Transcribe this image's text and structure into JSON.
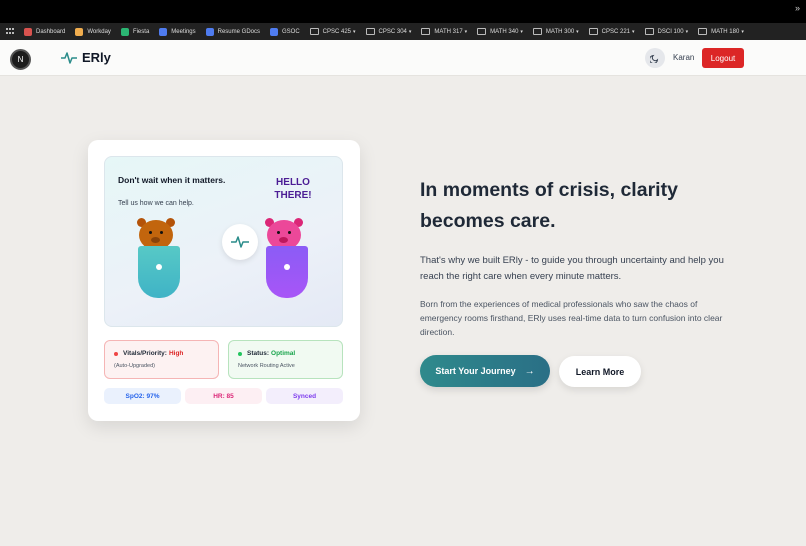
{
  "bookmarks": {
    "items": [
      {
        "label": "Dashboard",
        "icon": "dashboard-bookmark-icon",
        "color": "#d9534f",
        "folder": false
      },
      {
        "label": "Workday",
        "icon": "workday-bookmark-icon",
        "color": "#f0ad4e",
        "folder": false
      },
      {
        "label": "Fiesta",
        "icon": "fiesta-bookmark-icon",
        "color": "#2bb673",
        "folder": false
      },
      {
        "label": "Meetings",
        "icon": "doc-bookmark-icon",
        "color": "#4f7cf0",
        "folder": false
      },
      {
        "label": "Resume GDocs",
        "icon": "doc-bookmark-icon",
        "color": "#4f7cf0",
        "folder": false
      },
      {
        "label": "GSOC",
        "icon": "doc-bookmark-icon",
        "color": "#4f7cf0",
        "folder": false
      },
      {
        "label": "CPSC 425",
        "icon": "folder-icon",
        "folder": true
      },
      {
        "label": "CPSC 304",
        "icon": "folder-icon",
        "folder": true
      },
      {
        "label": "MATH 317",
        "icon": "folder-icon",
        "folder": true
      },
      {
        "label": "MATH 340",
        "icon": "folder-icon",
        "folder": true
      },
      {
        "label": "MATH 300",
        "icon": "folder-icon",
        "folder": true
      },
      {
        "label": "CPSC 221",
        "icon": "folder-icon",
        "folder": true
      },
      {
        "label": "DSCI 100",
        "icon": "folder-icon",
        "folder": true
      },
      {
        "label": "MATH 180",
        "icon": "folder-icon",
        "folder": true
      }
    ],
    "more": "»"
  },
  "header": {
    "badge": "N",
    "brand": "ERly",
    "user": "Karan",
    "logout": "Logout",
    "accent": "#dc2626"
  },
  "card": {
    "tagline": "Don't wait when it matters.",
    "subtagline": "Tell us how we can help.",
    "greeting": "HELLO THERE!",
    "vitals_label": "Vitals/Priority:",
    "vitals_value": "High",
    "vitals_note": "(Auto-Upgraded)",
    "status_label": "Status:",
    "status_value": "Optimal",
    "status_note": "Network Routing Active",
    "pills": [
      "SpO2: 97%",
      "HR: 85",
      "Synced"
    ]
  },
  "main": {
    "headline": "In moments of crisis, clarity becomes care.",
    "paragraph1": "That's why we built ERly - to guide you through uncertainty and help you reach the right care when every minute matters.",
    "paragraph2": "Born from the experiences of medical professionals who saw the chaos of emergency rooms firsthand, ERly uses real-time data to turn confusion into clear direction.",
    "cta_primary": "Start Your Journey",
    "cta_secondary": "Learn More",
    "cta_color": "#2f8a8c"
  }
}
